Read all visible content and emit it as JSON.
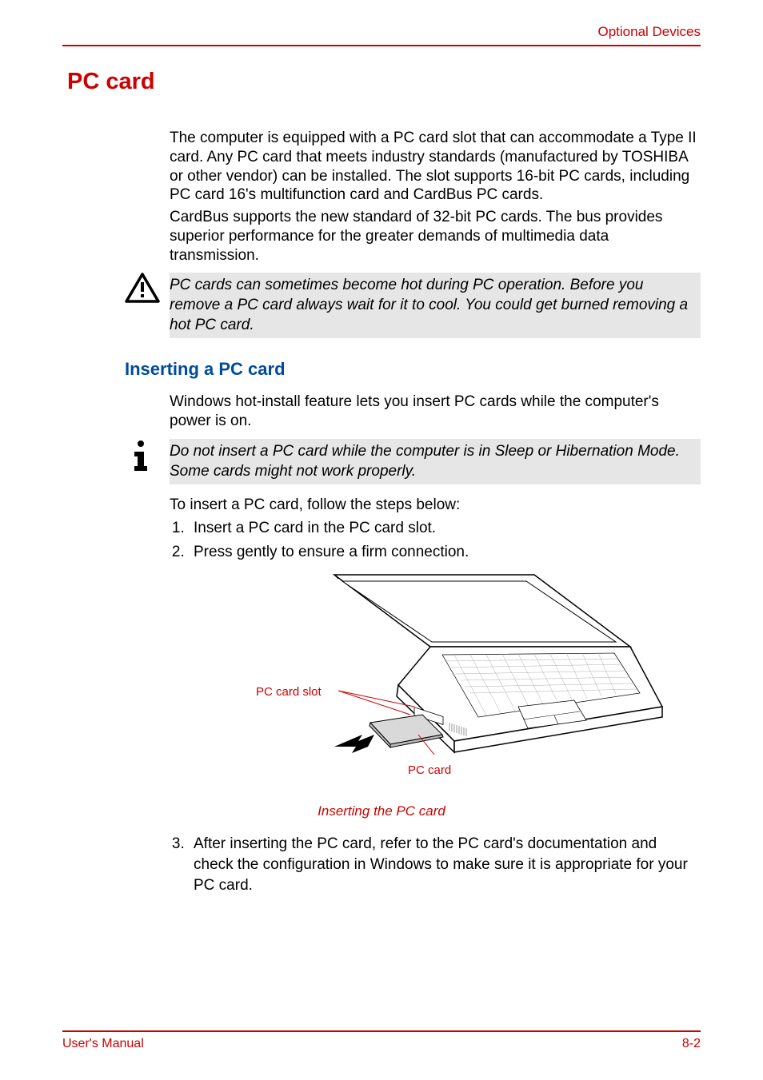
{
  "header": {
    "right": "Optional Devices"
  },
  "headings": {
    "main": "PC card",
    "sub": "Inserting a PC card"
  },
  "paragraphs": {
    "intro1": "The computer is equipped with a PC card slot that can accommodate a Type II card. Any PC card that meets industry standards (manufactured by TOSHIBA or other vendor) can be installed. The slot supports 16-bit PC cards, including PC card 16's multifunction card and CardBus PC cards.",
    "intro2": "CardBus supports the new standard of 32-bit PC cards. The bus provides superior performance for the greater demands of multimedia data transmission.",
    "insert_intro": "Windows hot-install feature lets you insert PC cards while the computer's power is on.",
    "insert_follow": "To insert a PC card, follow the steps below:"
  },
  "callouts": {
    "warning": "PC cards can sometimes become hot during PC operation. Before you remove a PC card always wait for it to cool. You could get burned removing a hot PC card.",
    "info": "Do not insert a PC card while the computer is in Sleep or Hibernation Mode. Some cards might not work properly."
  },
  "steps": {
    "s1": "Insert a PC card in the PC card slot.",
    "s2": "Press gently to ensure a firm connection.",
    "s3": "After inserting the PC card, refer to the PC card's documentation and check the configuration in Windows to make sure it is appropriate for your PC card."
  },
  "figure": {
    "label_slot": "PC card slot",
    "label_card": "PC card",
    "caption": "Inserting the PC card"
  },
  "footer": {
    "left": "User's Manual",
    "right": "8-2"
  }
}
